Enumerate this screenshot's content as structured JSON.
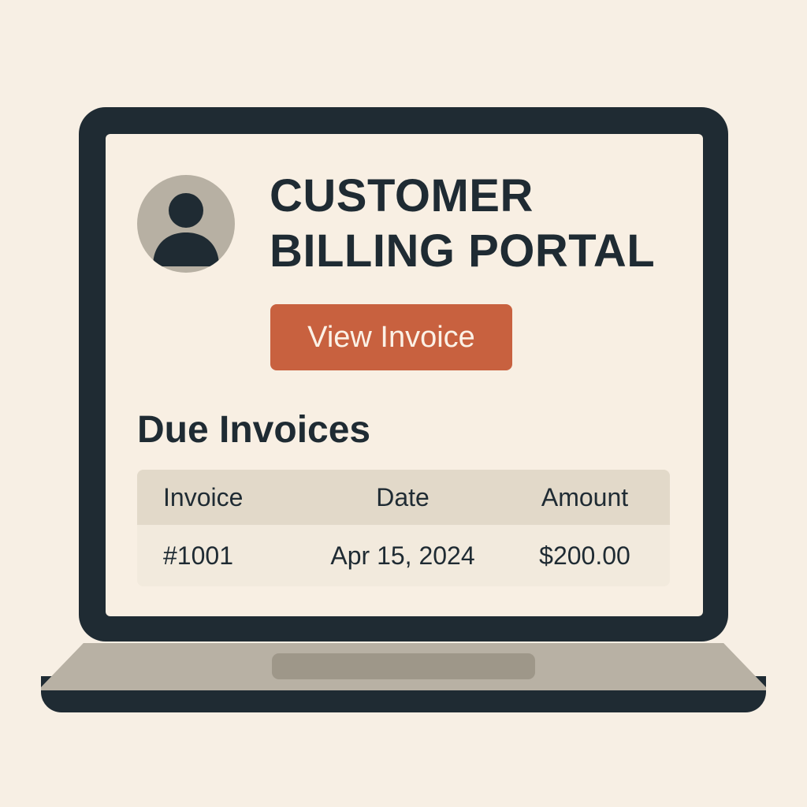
{
  "header": {
    "title_line1": "CUSTOMER",
    "title_line2": "BILLING PORTAL",
    "avatar_icon": "user-avatar-icon"
  },
  "actions": {
    "view_invoice_label": "View Invoice"
  },
  "invoices": {
    "heading": "Due Invoices",
    "columns": [
      "Invoice",
      "Date",
      "Amount"
    ],
    "rows": [
      {
        "invoice": "#1001",
        "date": "Apr 15, 2024",
        "amount": "$200.00"
      }
    ]
  },
  "colors": {
    "background": "#f7efe4",
    "laptop_frame": "#1f2b33",
    "accent_button": "#c8613f",
    "avatar_bg": "#b7b0a3",
    "table_header": "#e2d9c9"
  }
}
